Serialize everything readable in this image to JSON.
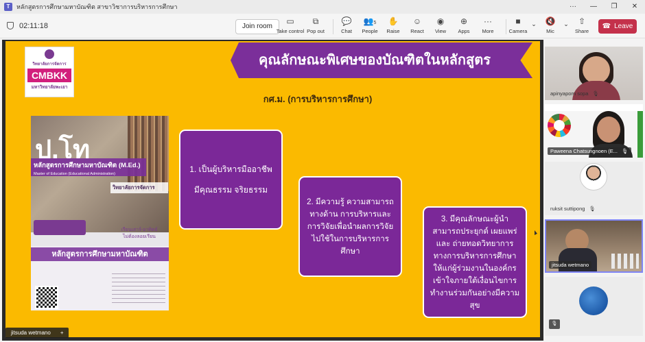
{
  "window": {
    "title": "หลักสูตรการศึกษามหาบัณฑิต สาขาวิชาการบริหารการศึกษา",
    "controls": [
      "···",
      "—",
      "❐",
      "✕"
    ]
  },
  "toolbar": {
    "timer": "02:11:18",
    "join_room": "Join room",
    "buttons": [
      {
        "label": "Take control",
        "icon": "▭"
      },
      {
        "label": "Pop out",
        "icon": "⧉"
      },
      {
        "label": "Chat",
        "icon": "💬"
      },
      {
        "label": "People",
        "icon": "👥",
        "count": "5"
      },
      {
        "label": "Raise",
        "icon": "✋"
      },
      {
        "label": "React",
        "icon": "☺"
      },
      {
        "label": "View",
        "icon": "◉"
      },
      {
        "label": "Apps",
        "icon": "⊕"
      },
      {
        "label": "More",
        "icon": "···"
      },
      {
        "label": "Camera",
        "icon": "■"
      },
      {
        "label": "Mic",
        "icon": "🔇"
      },
      {
        "label": "Share",
        "icon": "⇧"
      }
    ],
    "leave": "Leave"
  },
  "slide": {
    "logo": {
      "line1": "วิทยาลัยการจัดการ",
      "brand": "CMBKK",
      "line3": "มหาวิทยาลัยพะเยา"
    },
    "banner_title": "คุณลักษณะพิเศษของบัณฑิตในหลักสูตร",
    "subtitle": "กศ.ม. (การบริหารการศึกษา)",
    "poster": {
      "big": "ป.โท",
      "band_th": "หลักสูตรการศึกษามหาบัณฑิต (M.Ed.)",
      "band_en": "Master of Education (Educational Administration)",
      "mid": "วิทยาลัยการจัดการ",
      "study_line1": "เรียนเสาร์-อาทิตย์",
      "study_line2": "ไม่ต้องลอยเรียน",
      "lower_heading": "หลักสูตรการศึกษามหาบัณฑิต"
    },
    "boxes": [
      "1. เป็นผู้บริหารมืออาชีพ มีคุณธรรม จริยธรรม",
      "2. มีความรู้ ความสามารถทางด้าน การบริหารและการวิจัยเพื่อนำผลการวิจัยไปใช้ในการบริหารการศึกษา",
      "3. มีคุณลักษณะผู้นำ สามารถประยุกต์ เผยแพร่ และ ถ่ายทอดวิทยาการทางการบริหารการศึกษาให้แก่ผู้ร่วมงานในองค์กรเข้าใจภายใต้เงื่อนไขการทำงานร่วมกันอย่างมีความสุข"
    ]
  },
  "presenter_name": "jitsuda wetmano",
  "participants": [
    {
      "name": "apinyaporn sopa"
    },
    {
      "name": "Paweena Chatsungnoen (E..."
    },
    {
      "name": "ruksit suttipong"
    },
    {
      "name": "jitsuda wetmano"
    },
    {
      "name": ""
    }
  ]
}
